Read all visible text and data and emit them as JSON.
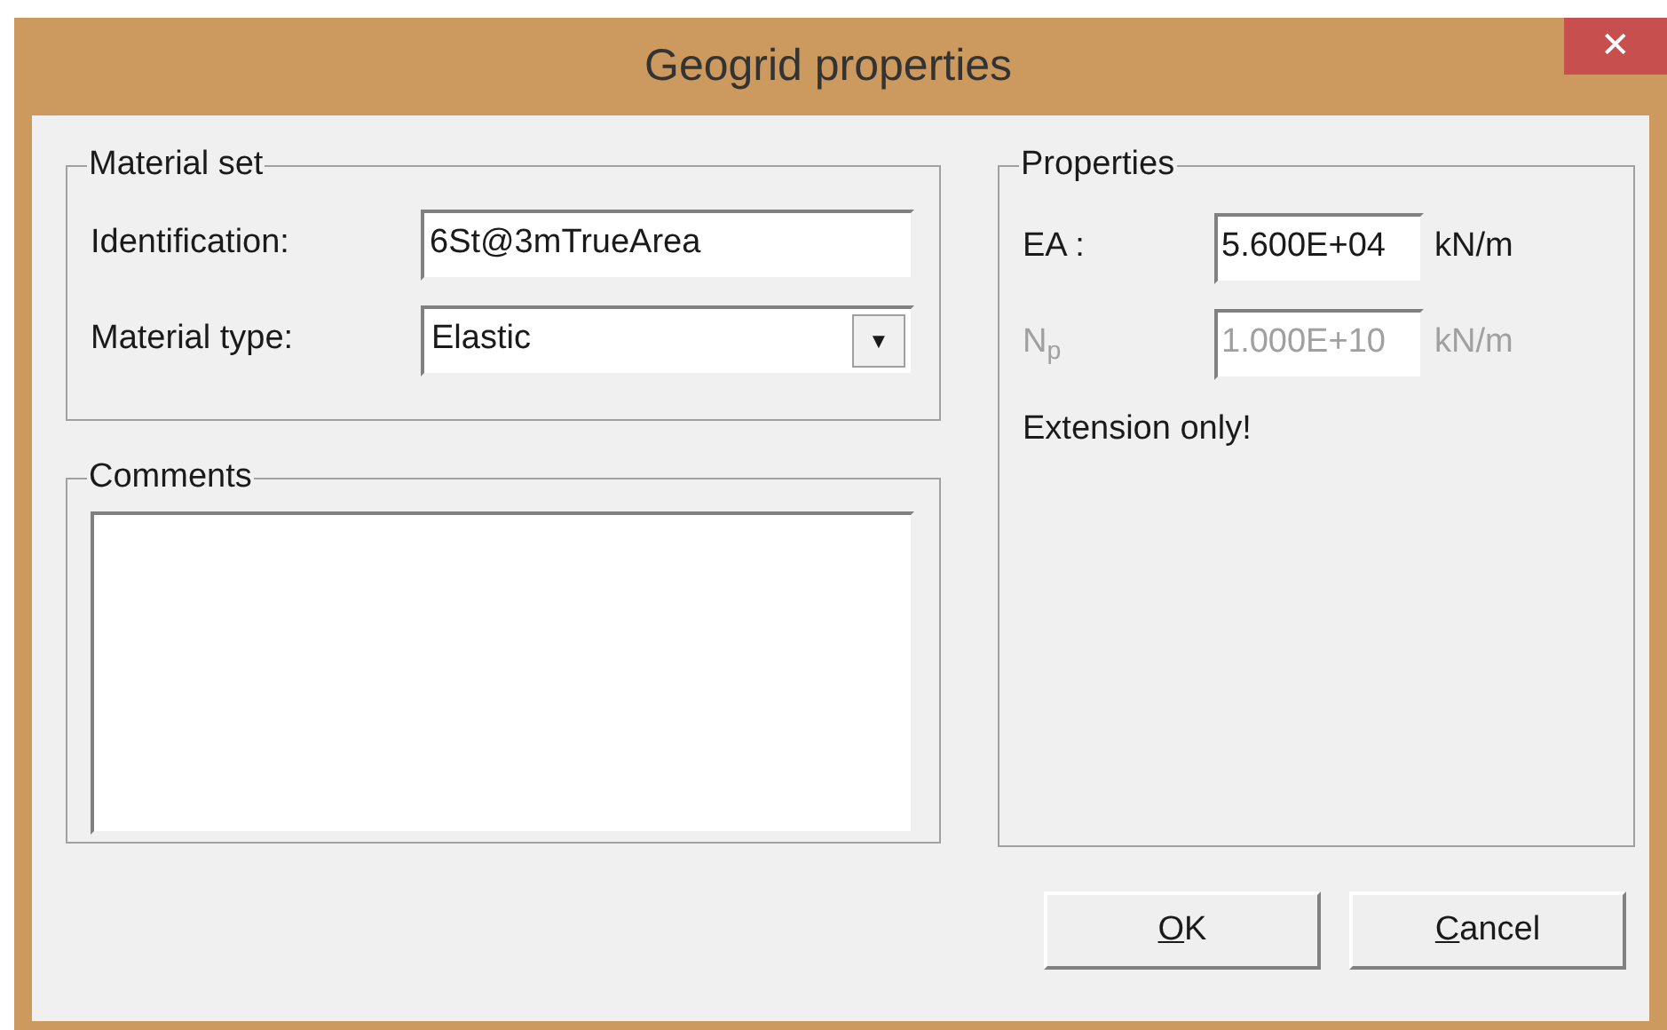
{
  "window": {
    "title": "Geogrid properties",
    "close": "✕"
  },
  "material_set": {
    "title": "Material set",
    "identification": {
      "label": "Identification:",
      "value": "6St@3mTrueArea"
    },
    "material_type": {
      "label": "Material type:",
      "value": "Elastic",
      "arrow": "▼"
    }
  },
  "comments": {
    "title": "Comments"
  },
  "properties": {
    "title": "Properties",
    "rows": [
      {
        "label": "EA :",
        "value": "5.600E+04",
        "unit": "kN/m",
        "disabled": false
      },
      {
        "label": "N$_{p}$",
        "value": "1.000E+10",
        "unit": "kN/m",
        "disabled": true
      }
    ],
    "note": "Extension only!"
  },
  "buttons": [
    "OK",
    "Cancel"
  ]
}
